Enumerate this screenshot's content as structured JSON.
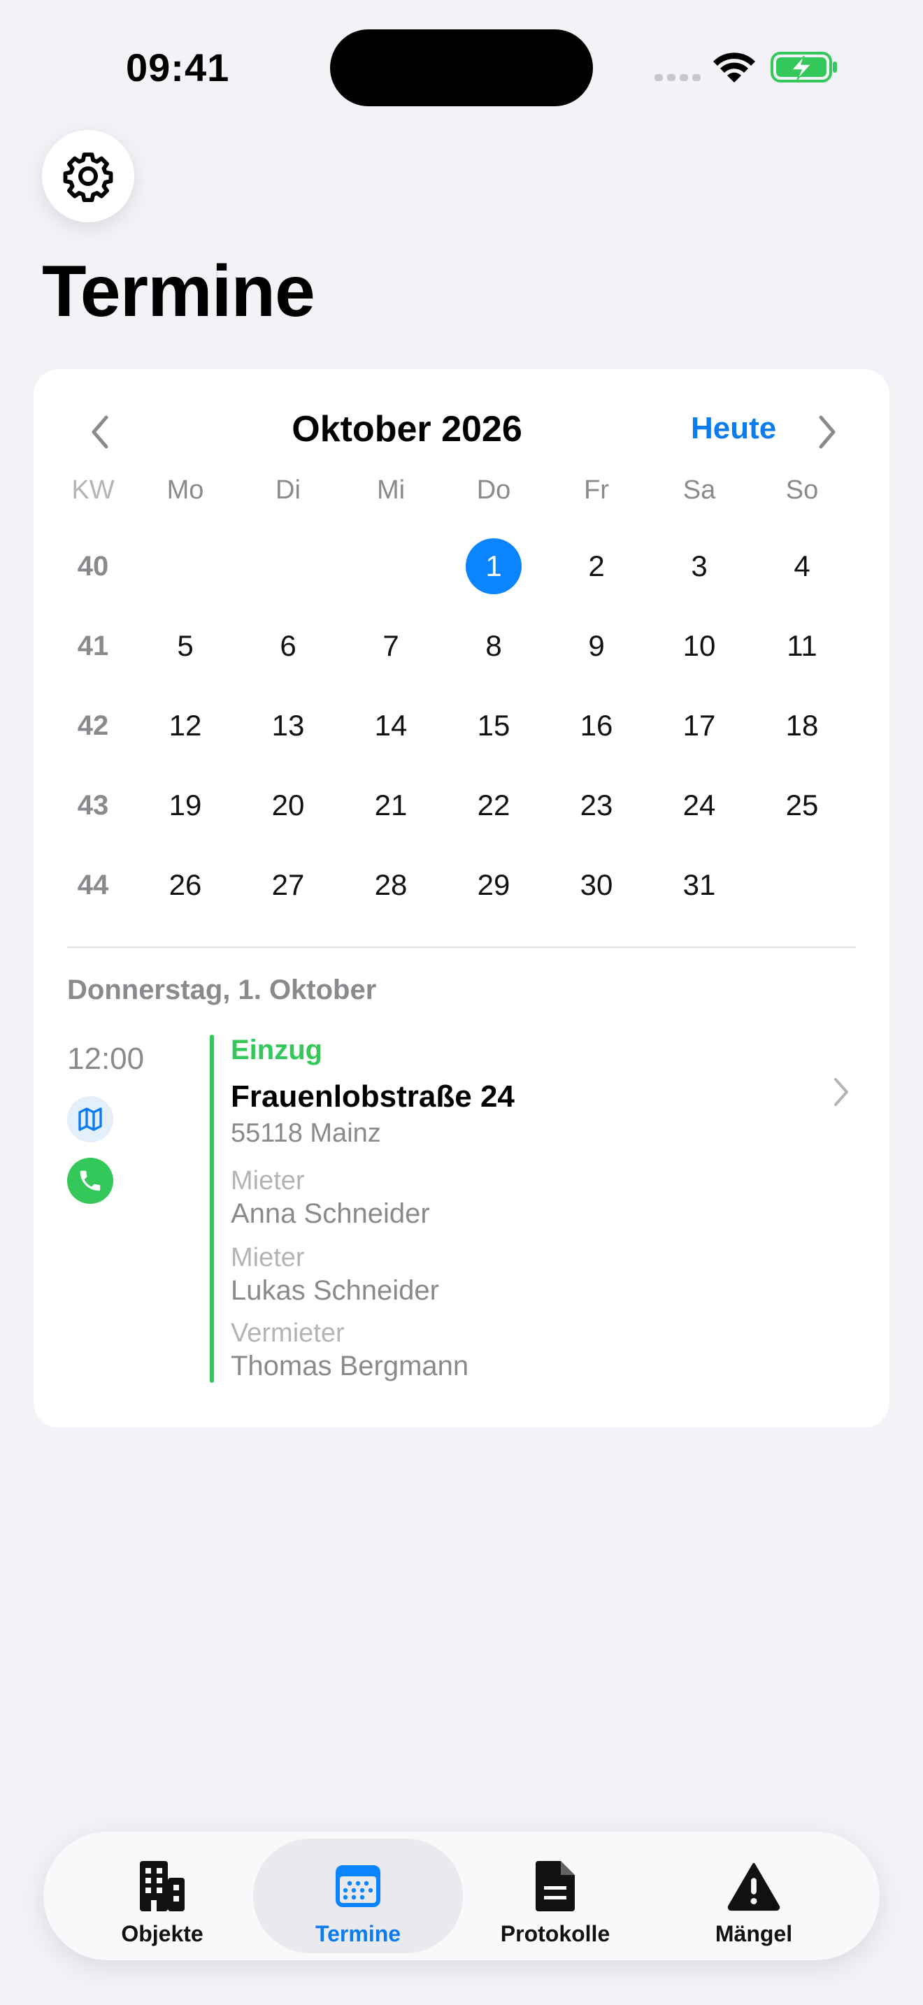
{
  "status_bar": {
    "time": "09:41"
  },
  "page": {
    "title": "Termine"
  },
  "calendar": {
    "month_title": "Oktober 2026",
    "today_label": "Heute",
    "weekday_headers": [
      "KW",
      "Mo",
      "Di",
      "Mi",
      "Do",
      "Fr",
      "Sa",
      "So"
    ],
    "weeks": [
      {
        "kw": "40",
        "days": [
          "",
          "",
          "",
          "1",
          "2",
          "3",
          "4"
        ]
      },
      {
        "kw": "41",
        "days": [
          "5",
          "6",
          "7",
          "8",
          "9",
          "10",
          "11"
        ]
      },
      {
        "kw": "42",
        "days": [
          "12",
          "13",
          "14",
          "15",
          "16",
          "17",
          "18"
        ]
      },
      {
        "kw": "43",
        "days": [
          "19",
          "20",
          "21",
          "22",
          "23",
          "24",
          "25"
        ]
      },
      {
        "kw": "44",
        "days": [
          "26",
          "27",
          "28",
          "29",
          "30",
          "31",
          ""
        ]
      }
    ],
    "selected_day": "1",
    "accent_color": "#0a84ff"
  },
  "selected_date": {
    "header": "Donnerstag, 1. Oktober",
    "appointment": {
      "time": "12:00",
      "type": "Einzug",
      "type_color": "#34c759",
      "street": "Frauenlobstraße 24",
      "city": "55118 Mainz",
      "participants": [
        {
          "role": "Mieter",
          "name": "Anna Schneider"
        },
        {
          "role": "Mieter",
          "name": "Lukas Schneider"
        },
        {
          "role": "Vermieter",
          "name": "Thomas Bergmann"
        }
      ]
    }
  },
  "tab_bar": {
    "tabs": [
      {
        "label": "Objekte",
        "icon": "building-icon",
        "active": false
      },
      {
        "label": "Termine",
        "icon": "calendar-icon",
        "active": true
      },
      {
        "label": "Protokolle",
        "icon": "document-icon",
        "active": false
      },
      {
        "label": "Mängel",
        "icon": "warning-icon",
        "active": false
      }
    ]
  }
}
